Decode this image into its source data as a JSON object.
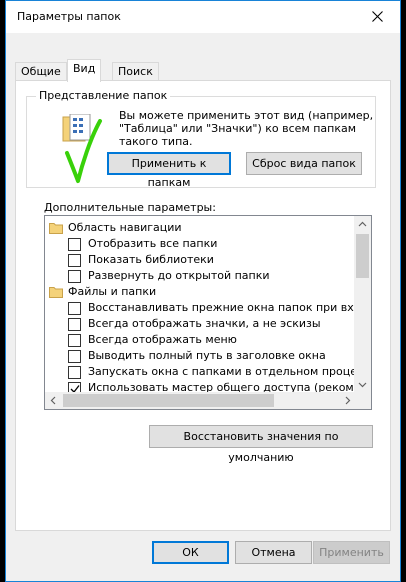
{
  "window": {
    "title": "Параметры папок"
  },
  "tabs": [
    {
      "label": "Общие"
    },
    {
      "label": "Вид",
      "active": true
    },
    {
      "label": "Поиск"
    }
  ],
  "view_group": {
    "legend": "Представление папок",
    "description": "Вы можете применить этот вид (например, \"Таблица\" или \"Значки\") ко всем папкам такого типа.",
    "apply_label": "Применить к папкам",
    "reset_label": "Сброс вида папок"
  },
  "advanced": {
    "label": "Дополнительные параметры:",
    "items": [
      {
        "type": "folder",
        "label": "Область навигации"
      },
      {
        "type": "checkbox",
        "label": "Отобразить все папки",
        "checked": false
      },
      {
        "type": "checkbox",
        "label": "Показать библиотеки",
        "checked": false
      },
      {
        "type": "checkbox",
        "label": "Развернуть до открытой папки",
        "checked": false
      },
      {
        "type": "folder",
        "label": "Файлы и папки"
      },
      {
        "type": "checkbox",
        "label": "Восстанавливать прежние окна папок при входе в систему",
        "checked": false
      },
      {
        "type": "checkbox",
        "label": "Всегда отображать значки, а не эскизы",
        "checked": false
      },
      {
        "type": "checkbox",
        "label": "Всегда отображать меню",
        "checked": false
      },
      {
        "type": "checkbox",
        "label": "Выводить полный путь в заголовке окна",
        "checked": false
      },
      {
        "type": "checkbox",
        "label": "Запускать окна с папками в отдельном процессе",
        "checked": false
      },
      {
        "type": "checkbox",
        "label": "Использовать мастер общего доступа (рекомендуется)",
        "checked": true
      }
    ],
    "restore_label": "Восстановить значения по умолчанию"
  },
  "footer": {
    "ok_label": "ОК",
    "cancel_label": "Отмена",
    "apply_label": "Применить"
  },
  "colors": {
    "accent": "#0078d7",
    "annotation_check": "#39d10a"
  }
}
